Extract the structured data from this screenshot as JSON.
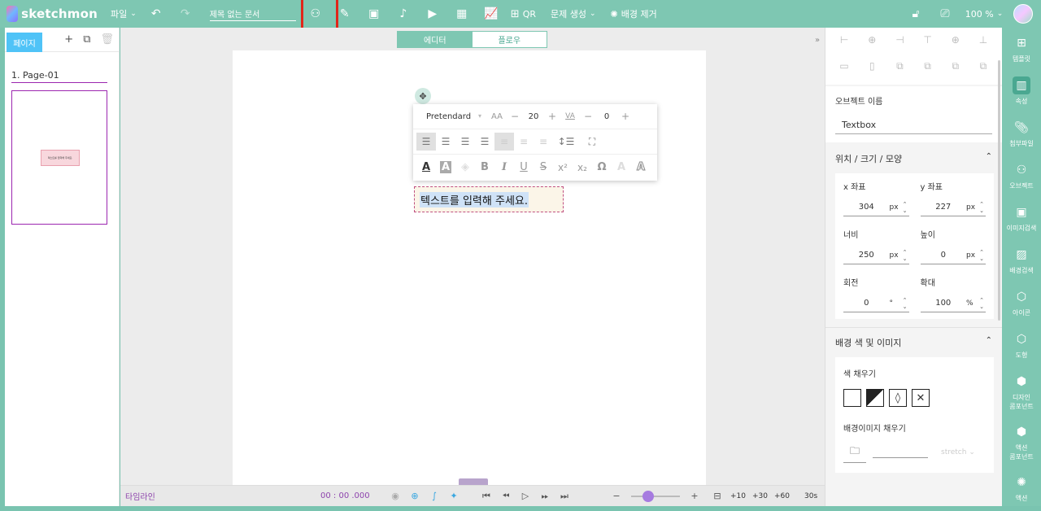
{
  "app": {
    "logo_text": "sketchmon",
    "file_menu": "파일",
    "doc_title": "제목 없는 문서",
    "qr_label": "QR",
    "problem_label": "문제 생성",
    "bg_remove_label": "배경 제거",
    "zoom": "100",
    "zoom_unit": "%"
  },
  "left_panel": {
    "tab_label": "페이지",
    "page_name": "1.  Page-01",
    "thumb_text": "텍스트를 입력해 주세요."
  },
  "canvas": {
    "mode_tabs": [
      "에디터",
      "플로우"
    ],
    "text_toolbar": {
      "font": "Pretendard",
      "font_size": "20",
      "letter_spacing": "0"
    },
    "textbox_text": "텍스트를 입력해 주세요."
  },
  "timeline": {
    "label": "타임라인",
    "time": "00 : 00 .000",
    "buttons": [
      "+10",
      "+30",
      "+60",
      "30s"
    ]
  },
  "right_panel": {
    "object_name_label": "오브젝트 이름",
    "object_name_value": "Textbox",
    "geom_title": "위치 / 크기 / 모양",
    "fields": [
      {
        "label": "x 좌표",
        "value": "304",
        "unit": "px"
      },
      {
        "label": "y 좌표",
        "value": "227",
        "unit": "px"
      },
      {
        "label": "너비",
        "value": "250",
        "unit": "px"
      },
      {
        "label": "높이",
        "value": "0",
        "unit": "px"
      },
      {
        "label": "회전",
        "value": "0",
        "unit": "°"
      },
      {
        "label": "확대",
        "value": "100",
        "unit": "%"
      }
    ],
    "bg_title": "배경 색 및 이미지",
    "fill_label": "색 채우기",
    "bgimg_label": "배경이미지 채우기",
    "stretch_label": "stretch"
  },
  "sidebar": {
    "items": [
      "템플릿",
      "속성",
      "첨부파일",
      "오브젝트",
      "이미지검색",
      "배경검색",
      "아이콘",
      "도형",
      "디자인\n콤포넌트",
      "액션\n콤포넌트",
      "액션"
    ]
  }
}
